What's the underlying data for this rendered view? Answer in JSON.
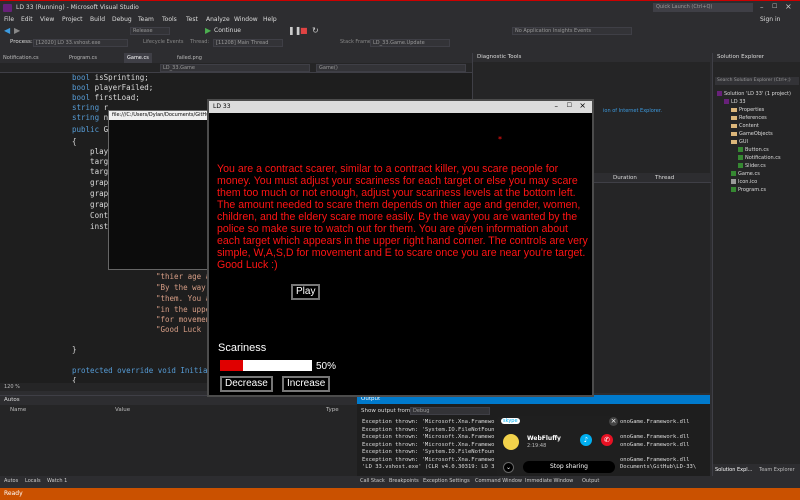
{
  "window": {
    "title": "LD 33 (Running) - Microsoft Visual Studio",
    "quick_launch": "Quick Launch (Ctrl+Q)",
    "sign_in": "Sign in"
  },
  "menu": [
    "File",
    "Edit",
    "View",
    "Project",
    "Build",
    "Debug",
    "Team",
    "Tools",
    "Test",
    "Analyze",
    "Window",
    "Help"
  ],
  "toolbar": {
    "config": "Release",
    "continue": "Continue",
    "app_insights": "No Application Insights Events"
  },
  "toolbar2": {
    "process_label": "Process:",
    "process": "[12020] LD 33.vshost.exe",
    "lifecycle": "Lifecycle Events",
    "thread_label": "Thread:",
    "thread": "[11208] Main Thread",
    "stack_label": "Stack Frame:",
    "stack": "LD_33.Game.Update"
  },
  "tabs": [
    "Notification.cs",
    "Program.cs",
    "Game.cs",
    "failed.png"
  ],
  "editor_nav": {
    "class": "LD_33.Game",
    "member": "Game()",
    "zoom": "120 %"
  },
  "code_lines": [
    {
      "kw": "bool",
      "rest": " isSprinting;"
    },
    {
      "kw": "bool",
      "rest": " playerFailed;"
    },
    {
      "kw": "bool",
      "rest": " firstLoad;"
    },
    {
      "kw": "string",
      "rest": " r"
    },
    {
      "kw": "string",
      "rest": " n"
    },
    {
      "kw": "public",
      "rest": " G"
    },
    {
      "kw": "",
      "rest": "{"
    },
    {
      "kw": "",
      "rest": "    play"
    },
    {
      "kw": "",
      "rest": "    targ"
    },
    {
      "kw": "",
      "rest": "    targ"
    },
    {
      "kw": "",
      "rest": "    grap"
    },
    {
      "kw": "",
      "rest": "    grap"
    },
    {
      "kw": "",
      "rest": "    grap"
    },
    {
      "kw": "",
      "rest": "    Cont"
    },
    {
      "kw": "",
      "rest": "    inst"
    }
  ],
  "code_strings": [
    "\"thier age a",
    "\"By the way",
    "\"them. You a",
    "\"in the uppe",
    "\"for movemen",
    "\"Good Luck"
  ],
  "code_bottom": {
    "brace": "}",
    "method": "protected override void Initial",
    "brace2": "{"
  },
  "console": {
    "title": "file:///C:/Users/Dylan/Documents/GitHub/LD-33/..."
  },
  "game": {
    "title": "LD 33",
    "dot": "*",
    "intro": "    You are a contract scarer, similar to a contract killer, you scare people for money. You must adjust your scariness for each target or else you may scare them too much or not enough, adjust your scariness levels at the bottom left. The amount needed to scare them depends on thier age and gender, women, children, and the eldery scare more easily. By the way you are wanted by the police so make sure to watch out for them. You are given information about each target which appears in the upper right hand corner. The controls are very simple, W,A,S,D for movement and E to scare once you are near you're target. Good Luck :)",
    "play": "Play",
    "scariness_label": "Scariness",
    "scariness_value": 0.5,
    "scariness_pct": "50%",
    "decrease": "Decrease",
    "increase": "Increase"
  },
  "diagnostics": {
    "title": "Diagnostic Tools",
    "ie_text": "ion of Internet Explorer.",
    "col_duration": "Duration",
    "col_thread": "Thread"
  },
  "solution": {
    "title": "Solution Explorer",
    "search": "Search Solution Explorer (Ctrl+;)",
    "items": [
      {
        "label": "Solution 'LD 33' (1 project)",
        "indent": 0,
        "kind": "sol"
      },
      {
        "label": "LD 33",
        "indent": 1,
        "kind": "proj"
      },
      {
        "label": "Properties",
        "indent": 2,
        "kind": "folder"
      },
      {
        "label": "References",
        "indent": 2,
        "kind": "folder"
      },
      {
        "label": "Content",
        "indent": 2,
        "kind": "folder"
      },
      {
        "label": "GameObjects",
        "indent": 2,
        "kind": "folder"
      },
      {
        "label": "GUI",
        "indent": 2,
        "kind": "folder"
      },
      {
        "label": "Button.cs",
        "indent": 3,
        "kind": "cs"
      },
      {
        "label": "Notification.cs",
        "indent": 3,
        "kind": "cs"
      },
      {
        "label": "Slider.cs",
        "indent": 3,
        "kind": "cs"
      },
      {
        "label": "Game.cs",
        "indent": 2,
        "kind": "cs"
      },
      {
        "label": "Icon.ico",
        "indent": 2,
        "kind": "ico"
      },
      {
        "label": "Program.cs",
        "indent": 2,
        "kind": "cs"
      }
    ],
    "tab_solution": "Solution Expl...",
    "tab_team": "Team Explorer"
  },
  "autos": {
    "title": "Autos",
    "col_name": "Name",
    "col_value": "Value",
    "col_type": "Type"
  },
  "output": {
    "title": "Output",
    "show_label": "Show output from:",
    "show_value": "Debug",
    "lines": [
      "Exception thrown: 'Microsoft.Xna.Framewo",
      "Exception thrown: 'System.IO.FileNotFoun",
      "Exception thrown: 'Microsoft.Xna.Framewo",
      "Exception thrown: 'Microsoft.Xna.Framewo",
      "Exception thrown: 'System.IO.FileNotFoun",
      "Exception thrown: 'Microsoft.Xna.Framewo",
      "'LD 33.vshost.exe' (CLR v4.0.30319: LD 3"
    ],
    "right_lines": [
      "onoGame.Framework.dll",
      "",
      "onoGame.Framework.dll",
      "onoGame.Framework.dll",
      "",
      "onoGame.Framework.dll",
      "Documents\\GitHub\\LD-33\\"
    ]
  },
  "bottom_tabs": {
    "autos": "Autos",
    "locals": "Locals",
    "watch": "Watch 1",
    "call_stack": "Call Stack",
    "breakpoints": "Breakpoints",
    "exceptions": "Exception Settings",
    "command": "Command Window",
    "immediate": "Immediate Window",
    "output": "Output"
  },
  "skype": {
    "brand": "skype",
    "name": "WebFluffy",
    "time": "2:19:48",
    "stop": "Stop sharing"
  },
  "status": {
    "text": "Ready"
  },
  "colors": {
    "accent": "#007acc",
    "status": "#ca5100",
    "game_text": "#ff1414",
    "bar": "#e00000"
  }
}
